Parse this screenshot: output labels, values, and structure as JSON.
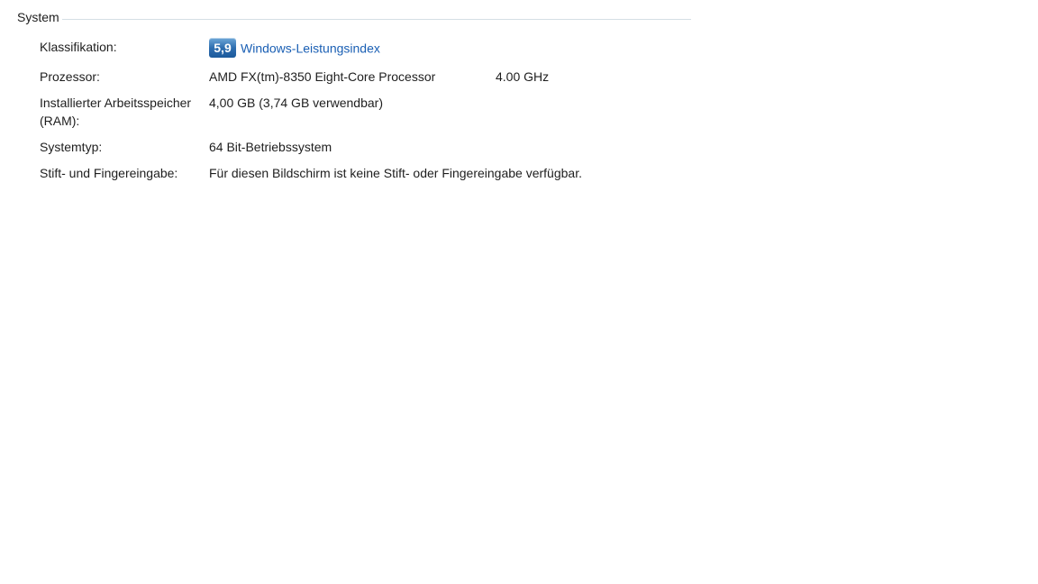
{
  "section": {
    "title": "System"
  },
  "rows": {
    "classification": {
      "label": "Klassifikation:",
      "badge": "5,9",
      "link": "Windows-Leistungsindex"
    },
    "processor": {
      "label": "Prozessor:",
      "value": "AMD FX(tm)-8350 Eight-Core Processor",
      "value2": "4.00 GHz"
    },
    "ram": {
      "label_line1": "Installierter Arbeitsspeicher",
      "label_line2": "(RAM):",
      "value": "4,00 GB (3,74 GB verwendbar)"
    },
    "systemtype": {
      "label": "Systemtyp:",
      "value": "64 Bit-Betriebssystem"
    },
    "pen": {
      "label": "Stift- und Fingereingabe:",
      "value": "Für diesen Bildschirm ist keine Stift- oder Fingereingabe verfügbar."
    }
  },
  "colors": {
    "link": "#1a5fb4",
    "badge": "#2f6fb0",
    "divider": "#d5dfe5"
  }
}
